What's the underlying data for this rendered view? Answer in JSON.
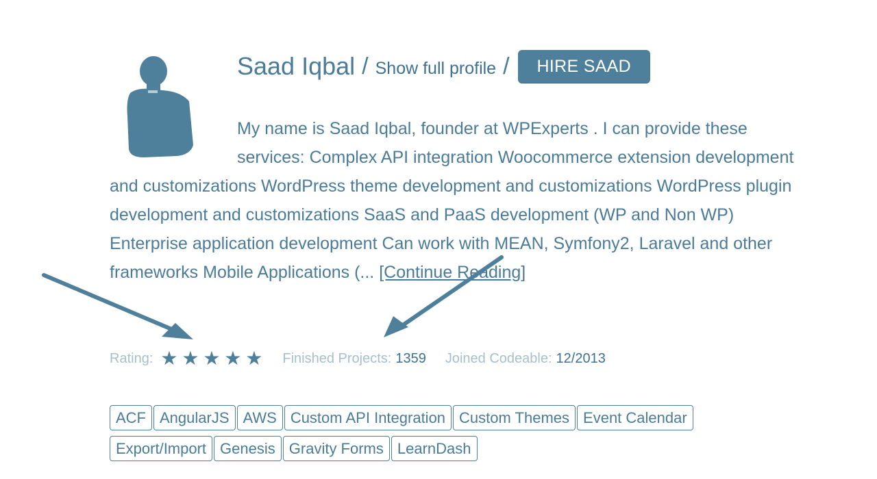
{
  "profile": {
    "name": "Saad Iqbal",
    "separator": "/",
    "show_full_profile": "Show full profile",
    "hire_button": "HIRE SAAD",
    "bio": "My name is Saad Iqbal, founder at WPExperts . I can provide these services: Complex API integration Woocommerce extension development and customizations WordPress theme development and customizations WordPress plugin development and customizations SaaS and PaaS development (WP and Non WP) Enterprise application development Can work with MEAN, Symfony2, Laravel and other frameworks Mobile Applications (...",
    "continue_reading": "[Continue Reading]"
  },
  "stats": {
    "rating_label": "Rating:",
    "rating_stars": 5,
    "finished_projects_label": "Finished Projects:",
    "finished_projects_value": "1359",
    "joined_label": "Joined Codeable:",
    "joined_value": "12/2013"
  },
  "tags": [
    "ACF",
    "AngularJS",
    "AWS",
    "Custom API Integration",
    "Custom Themes",
    "Event Calendar",
    "Export/Import",
    "Genesis",
    "Gravity Forms",
    "LearnDash"
  ],
  "colors": {
    "primary": "#4a7b98",
    "button_bg": "#4e7f9b",
    "muted_label": "#a7bfcd",
    "annotation_arrow": "#4e7f9b"
  },
  "icons": {
    "star": "star-icon",
    "avatar": "person-silhouette",
    "arrow": "annotation-arrow"
  }
}
